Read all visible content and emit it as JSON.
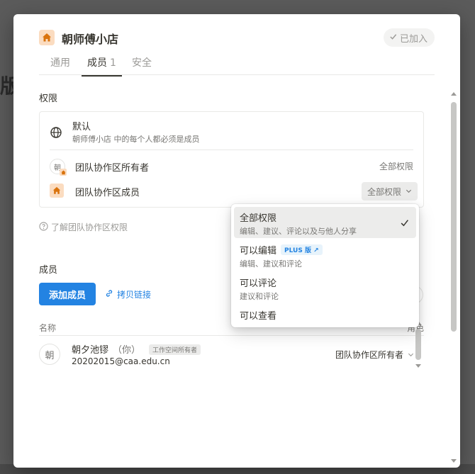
{
  "backdrop": {
    "text": "版"
  },
  "header": {
    "workspace_name": "朝师傅小店",
    "joined_label": "已加入",
    "home_icon": "home-icon",
    "check_icon": "check-icon"
  },
  "tabs": [
    {
      "label": "通用",
      "count": ""
    },
    {
      "label": "成员",
      "count": "1"
    },
    {
      "label": "安全",
      "count": ""
    }
  ],
  "permissions": {
    "section_title": "权限",
    "default_title": "默认",
    "default_desc": "朝师傅小店 中的每个人都必须是成员",
    "rows": [
      {
        "avatar": "朝",
        "label": "团队协作区所有者",
        "value": "全部权限"
      },
      {
        "label": "团队协作区成员",
        "value": "全部权限"
      }
    ],
    "learn_link": "了解团队协作区权限"
  },
  "members": {
    "section_title": "成员",
    "add_button": "添加成员",
    "copy_link": "拷贝链接",
    "col_name": "名称",
    "col_role": "角色",
    "list": [
      {
        "avatar": "朝",
        "name": "朝夕池镠",
        "you": "（你）",
        "tag": "工作空间所有者",
        "email": "20202015@caa.edu.cn",
        "role": "团队协作区所有者"
      }
    ]
  },
  "menu": {
    "items": [
      {
        "title": "全部权限",
        "desc": "编辑、建议、评论以及与他人分享",
        "selected": true
      },
      {
        "title": "可以编辑",
        "badge": "PLUS 版 ↗",
        "desc": "编辑、建议和评论"
      },
      {
        "title": "可以评论",
        "desc": "建议和评论"
      },
      {
        "title": "可以查看",
        "desc": ""
      }
    ]
  },
  "colors": {
    "accent": "#2383e2",
    "home_badge": "#fbdcc0"
  }
}
